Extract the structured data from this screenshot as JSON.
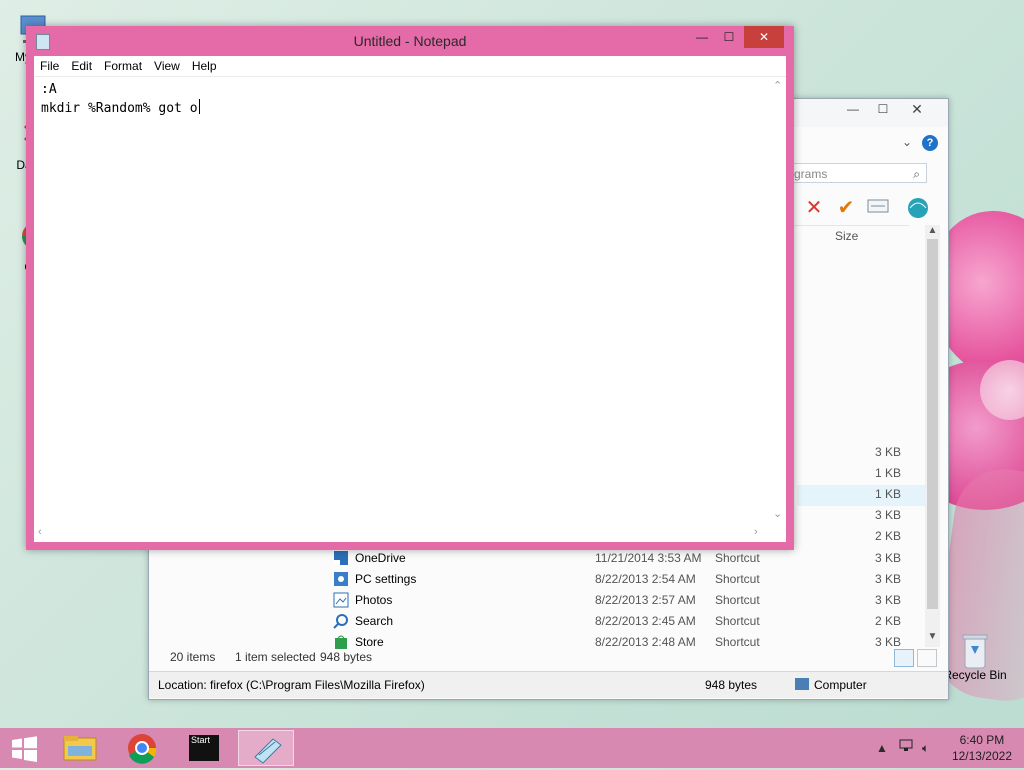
{
  "notepad": {
    "title": "Untitled - Notepad",
    "menu": [
      "File",
      "Edit",
      "Format",
      "View",
      "Help"
    ],
    "lines": [
      ":A",
      "mkdir %Random% got o"
    ]
  },
  "explorer": {
    "search_placeholder": "grams",
    "column_size": "Size",
    "partial_sizes": [
      "3 KB",
      "1 KB",
      "1 KB",
      "3 KB",
      "2 KB"
    ],
    "files": [
      {
        "name": "OneDrive",
        "date": "11/21/2014 3:53 AM",
        "type": "Shortcut",
        "size": "3 KB"
      },
      {
        "name": "PC settings",
        "date": "8/22/2013 2:54 AM",
        "type": "Shortcut",
        "size": "3 KB"
      },
      {
        "name": "Photos",
        "date": "8/22/2013 2:57 AM",
        "type": "Shortcut",
        "size": "3 KB"
      },
      {
        "name": "Search",
        "date": "8/22/2013 2:45 AM",
        "type": "Shortcut",
        "size": "2 KB"
      },
      {
        "name": "Store",
        "date": "8/22/2013 2:48 AM",
        "type": "Shortcut",
        "size": "3 KB"
      }
    ],
    "status": {
      "items": "20 items",
      "selected": "1 item selected",
      "bytes": "948 bytes"
    },
    "bottom": {
      "location": "Location: firefox (C:\\Program Files\\Mozilla Firefox)",
      "bytes": "948 bytes",
      "computer": "Computer"
    }
  },
  "desktop": {
    "icons": [
      "My C",
      "Data",
      "G",
      "Recycle Bin"
    ]
  },
  "taskbar": {
    "start_tile_label": "Start",
    "time": "6:40 PM",
    "date": "12/13/2022"
  },
  "colors": {
    "notepad_frame": "#e46aa8",
    "taskbar": "#d889b2",
    "close_button": "#c7403c"
  }
}
